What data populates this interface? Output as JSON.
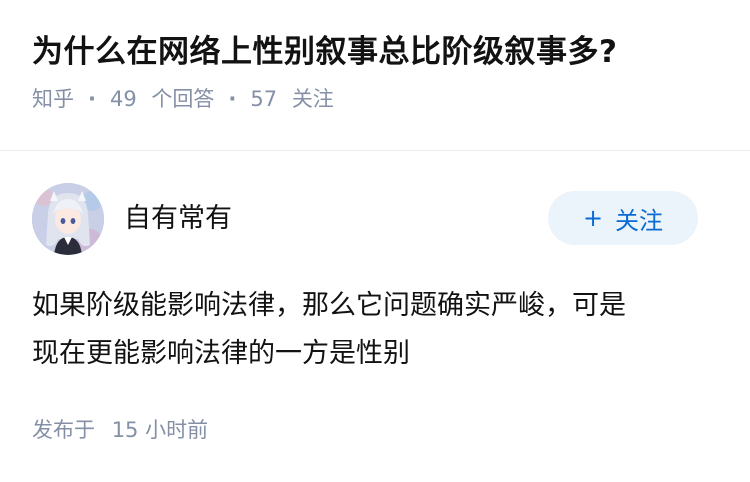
{
  "question": {
    "title": "为什么在网络上性别叙事总比阶级叙事多?",
    "source": "知乎",
    "answers_count": "49",
    "answers_label": "个回答",
    "followers_count": "57",
    "followers_label": "关注"
  },
  "answer": {
    "author_name": "自有常有",
    "follow_label": "关注",
    "follow_prefix": "+",
    "content_line1": "如果阶级能影响法律，那么它问题确实严峻，可是",
    "content_line2": "现在更能影响法律的一方是性别",
    "time_prefix": "发布于",
    "time_value": "15 小时前"
  },
  "colors": {
    "primary_text": "#121212",
    "secondary_text": "#8590a6",
    "accent_blue": "#0b6bd3",
    "follow_bg": "#ebf3fb"
  },
  "icons": {
    "avatar": "anime-girl-avatar",
    "follow": "plus-icon"
  }
}
